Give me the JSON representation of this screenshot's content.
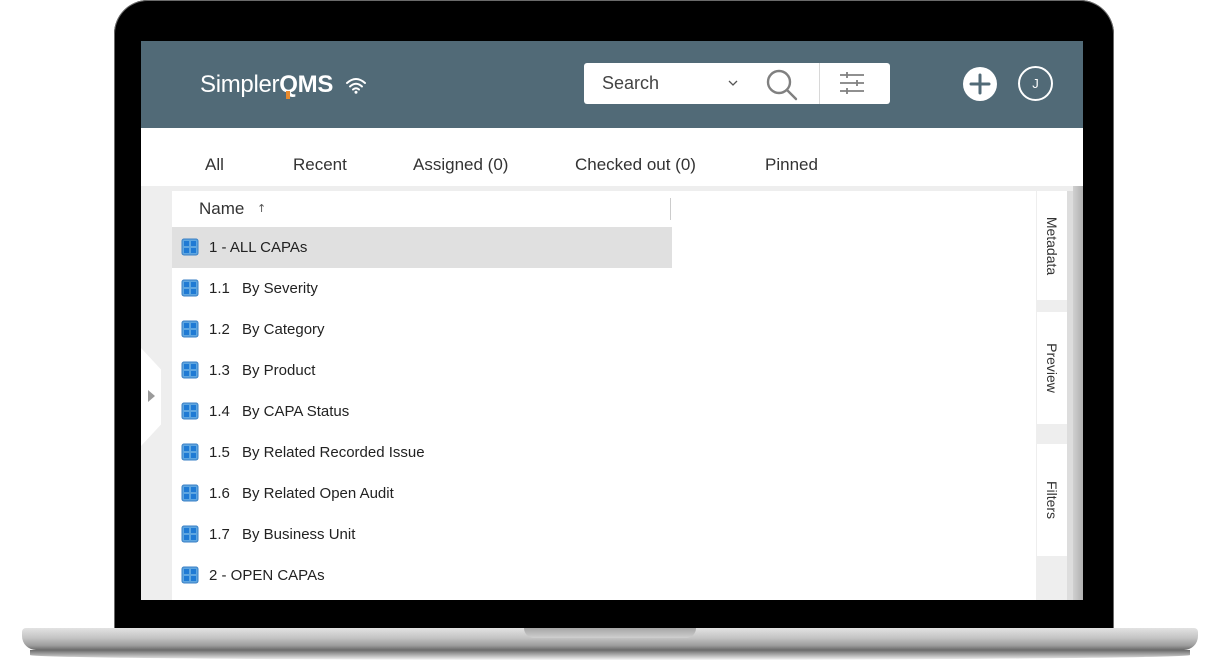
{
  "header": {
    "logo_text_light": "Simpler",
    "logo_text_bold": "QMS",
    "logo_icon": "wifi-icon",
    "search": {
      "placeholder": "Search",
      "dropdown_icon": "chevron-down-icon",
      "search_icon": "search-icon",
      "filter_icon": "sliders-icon"
    },
    "add_icon": "plus-circle-icon",
    "avatar_initial": "J"
  },
  "tabs": [
    {
      "label": "All"
    },
    {
      "label": "Recent"
    },
    {
      "label": "Assigned (0)"
    },
    {
      "label": "Checked out (0)"
    },
    {
      "label": "Pinned"
    }
  ],
  "list": {
    "column_header": "Name",
    "sort_indicator": "↑",
    "rows": [
      {
        "num": "",
        "label": "1 - ALL CAPAs",
        "selected": true,
        "icon": "grid-view-icon"
      },
      {
        "num": "1.1",
        "label": "By Severity",
        "icon": "grid-view-icon"
      },
      {
        "num": "1.2",
        "label": "By Category",
        "icon": "grid-view-icon"
      },
      {
        "num": "1.3",
        "label": "By Product",
        "icon": "grid-view-icon"
      },
      {
        "num": "1.4",
        "label": "By CAPA Status",
        "icon": "grid-view-icon"
      },
      {
        "num": "1.5",
        "label": "By Related Recorded Issue",
        "icon": "grid-view-icon"
      },
      {
        "num": "1.6",
        "label": "By Related Open Audit",
        "icon": "grid-view-icon"
      },
      {
        "num": "1.7",
        "label": "By Business Unit",
        "icon": "grid-view-icon"
      },
      {
        "num": "",
        "label": "2 - OPEN CAPAs",
        "icon": "grid-view-icon"
      }
    ]
  },
  "side_tabs": [
    {
      "label": "Metadata"
    },
    {
      "label": "Preview"
    },
    {
      "label": "Filters"
    }
  ],
  "colors": {
    "topbar": "#516a77",
    "accent_orange": "#e88a2e",
    "icon_blue": "#1f7ad4",
    "selected_row": "#e0e0e0"
  }
}
